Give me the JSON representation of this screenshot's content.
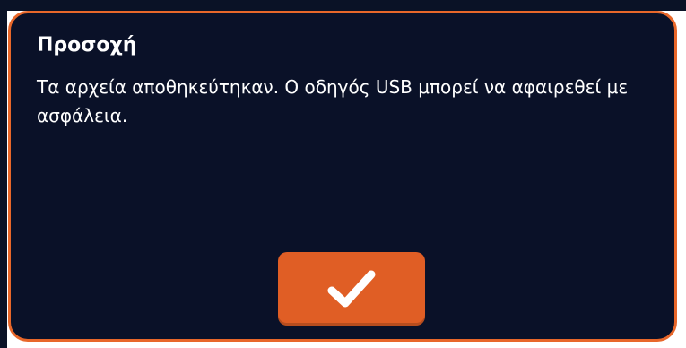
{
  "dialog": {
    "title": "Προσοχή",
    "message": "Τα αρχεία αποθηκεύτηκαν. Ο οδηγός USB μπορεί να αφαιρεθεί με ασφάλεια.",
    "confirm_button": {
      "icon": "checkmark-icon"
    }
  },
  "colors": {
    "background": "#0a1128",
    "accent": "#e8672a",
    "button": "#e05e25",
    "text": "#ffffff"
  }
}
